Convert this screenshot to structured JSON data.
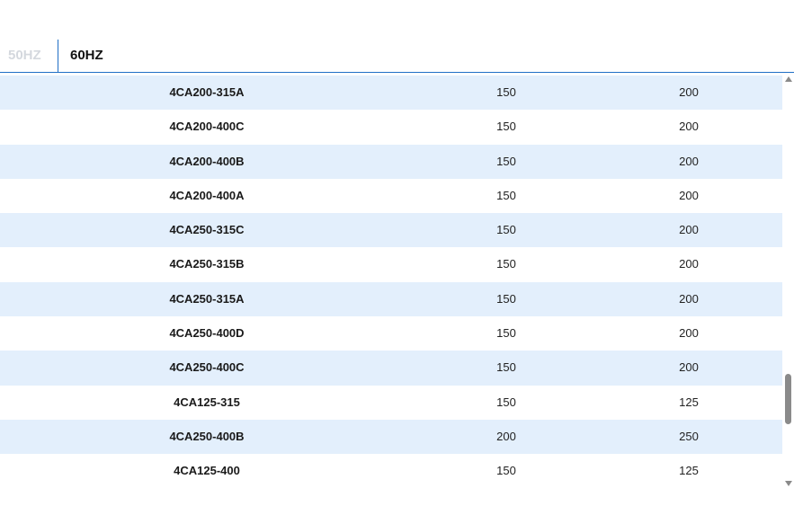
{
  "tabs": {
    "hz50": "50HZ",
    "hz60": "60HZ",
    "active": "60HZ"
  },
  "table": {
    "rows": [
      {
        "model": "4CA200-315A",
        "a": "150",
        "b": "200"
      },
      {
        "model": "4CA200-400C",
        "a": "150",
        "b": "200"
      },
      {
        "model": "4CA200-400B",
        "a": "150",
        "b": "200"
      },
      {
        "model": "4CA200-400A",
        "a": "150",
        "b": "200"
      },
      {
        "model": "4CA250-315C",
        "a": "150",
        "b": "200"
      },
      {
        "model": "4CA250-315B",
        "a": "150",
        "b": "200"
      },
      {
        "model": "4CA250-315A",
        "a": "150",
        "b": "200"
      },
      {
        "model": "4CA250-400D",
        "a": "150",
        "b": "200"
      },
      {
        "model": "4CA250-400C",
        "a": "150",
        "b": "200"
      },
      {
        "model": "4CA125-315",
        "a": "150",
        "b": "125"
      },
      {
        "model": "4CA250-400B",
        "a": "200",
        "b": "250"
      },
      {
        "model": "4CA125-400",
        "a": "150",
        "b": "125"
      }
    ]
  },
  "colors": {
    "accent": "#1f6fc5",
    "row_alt": "#e3effc",
    "inactive_tab": "#d4d8de"
  },
  "scrollbar": {
    "position": 0.85
  }
}
